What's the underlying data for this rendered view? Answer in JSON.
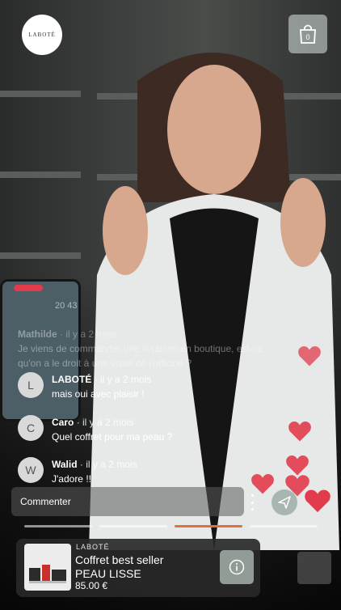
{
  "brand": {
    "logo_text": "LABOTÉ"
  },
  "cart": {
    "count": "0"
  },
  "viewers": "20 43",
  "comments": [
    {
      "initial": "",
      "name": "Mathilde",
      "time": "· il y a 2 mois",
      "text": "Je viens de commander une livraison en boutique, est-ce qu'on a le droit à une visite de l'officine ?"
    },
    {
      "initial": "L",
      "name": "LABOTÉ",
      "time": "· il y a 2 mois",
      "text": "mais oui avec plaisir !"
    },
    {
      "initial": "C",
      "name": "Caro",
      "time": "· il y a 2 mois",
      "text": "Quel coffret pour ma peau ?"
    },
    {
      "initial": "W",
      "name": "Walid",
      "time": "· il y a 2 mois",
      "text": "J'adore !!"
    }
  ],
  "input": {
    "placeholder": "Commenter"
  },
  "progress": {
    "segments": 4,
    "active": 2
  },
  "product": {
    "brand": "LABOTÉ",
    "title": "Coffret best seller PEAU LISSE",
    "price": "85.00 €"
  },
  "colors": {
    "accent": "#e0713c",
    "heart": "#e23b4b",
    "cart_bg": "#dce6e1",
    "info_bg": "#909c95"
  }
}
